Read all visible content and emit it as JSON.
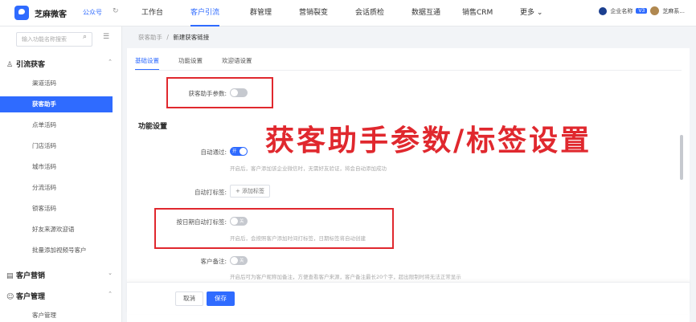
{
  "header": {
    "brand": "芝麻微客",
    "sub_account": "公众号",
    "nav": [
      "工作台",
      "客户引流",
      "群管理",
      "营销裂变",
      "会话质检",
      "数据互通",
      "销售CRM",
      "更多 ⌄"
    ],
    "active_nav": "客户引流",
    "org_name": "企业名称",
    "version_badge": "V3",
    "user_name": "芝麻系..."
  },
  "sidebar": {
    "search_placeholder": "输入功能名称搜索",
    "groups": [
      {
        "label": "引流获客",
        "icon": "people-icon",
        "expanded": true
      },
      {
        "label": "客户营销",
        "icon": "calendar-icon",
        "expanded": false
      },
      {
        "label": "客户管理",
        "icon": "user-icon",
        "expanded": true
      }
    ],
    "items": [
      "渠道活码",
      "获客助手",
      "点单活码",
      "门店活码",
      "城市活码",
      "分流活码",
      "锁客活码",
      "好友来源欢迎语",
      "批量添加视频号客户",
      "客户管理"
    ],
    "active_item": "获客助手"
  },
  "breadcrumb": {
    "parent": "获客助手",
    "sep": "/",
    "current": "新建获客链接"
  },
  "tabs": [
    "基础设置",
    "功能设置",
    "欢迎语设置"
  ],
  "active_tab": "基础设置",
  "form": {
    "assist_param_label": "获客助手参数:",
    "section_title": "功能设置",
    "auto_pass_label": "自动通过:",
    "auto_pass_state": "开",
    "auto_pass_hint": "开启后，客户添加该企业微信时，无需好友验证，将会自动添加成功",
    "auto_tag_label": "自动打标签:",
    "add_tag_button": "+ 添加标签",
    "date_tag_label": "按日期自动打标签:",
    "date_tag_state": "关",
    "date_tag_hint": "开启后，会按照客户添加时间打标签，日期标签将自动创建",
    "remark_label": "客户备注:",
    "remark_state": "关",
    "remark_hint": "开启后可为客户昵称加备注，方便查看客户来源，客户备注最长20个字，超出限制时将无法正常显示"
  },
  "overlay_text": "获客助手参数/标签设置",
  "footer": {
    "cancel": "取消",
    "save": "保存"
  },
  "colors": {
    "accent": "#2f6bff",
    "highlight": "#e0282e"
  }
}
